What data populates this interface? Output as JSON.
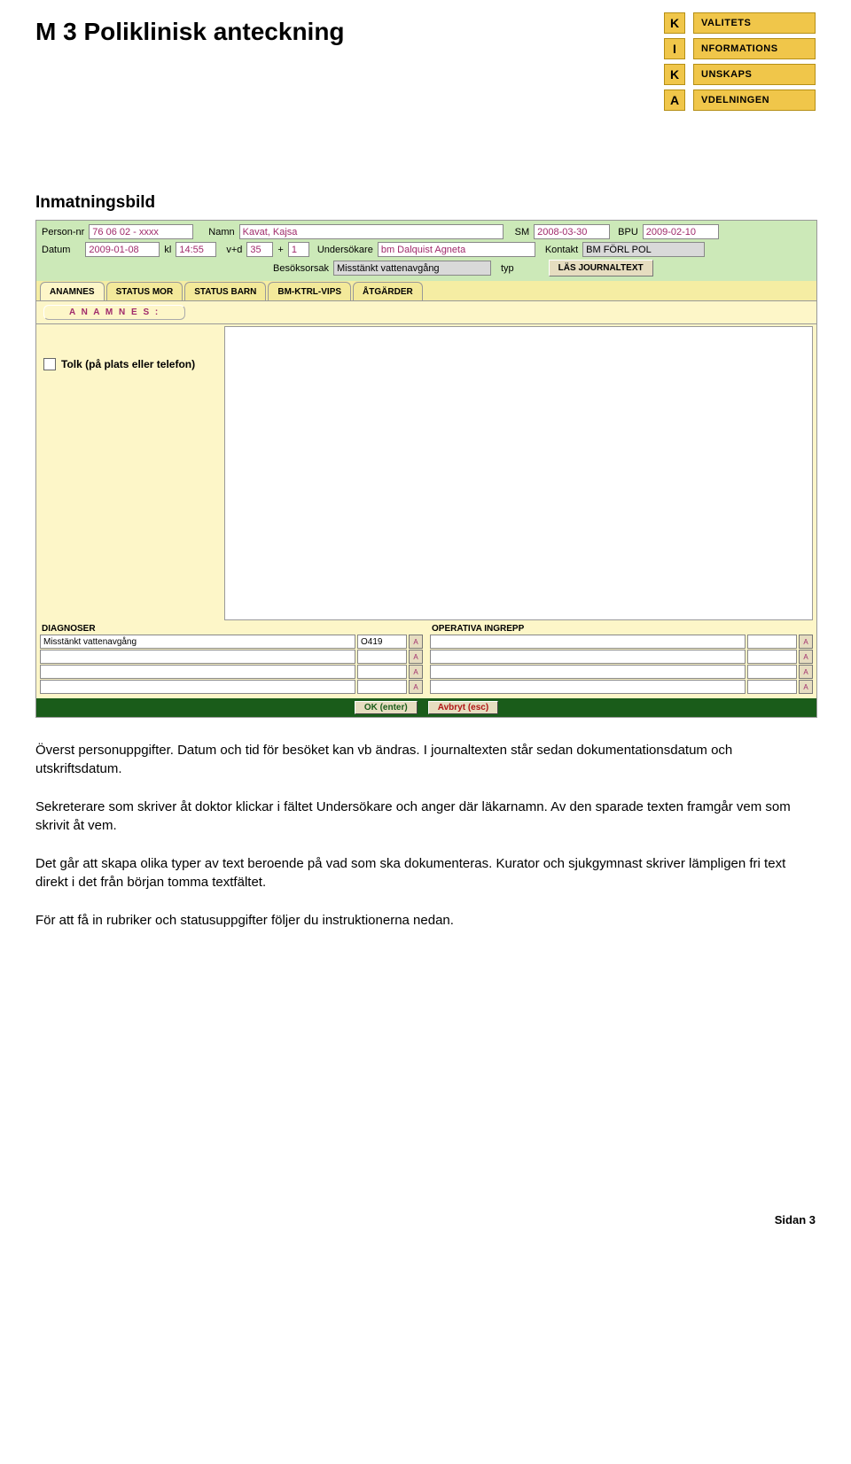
{
  "title": "M 3   Poliklinisk anteckning",
  "kika": [
    {
      "letter": "K",
      "word": "VALITETS"
    },
    {
      "letter": "I",
      "word": "NFORMATIONS"
    },
    {
      "letter": "K",
      "word": "UNSKAPS"
    },
    {
      "letter": "A",
      "word": "VDELNINGEN"
    }
  ],
  "section_heading": "Inmatningsbild",
  "form": {
    "personnr_lbl": "Person-nr",
    "personnr": "76 06 02 - xxxx",
    "namn_lbl": "Namn",
    "namn": "Kavat, Kajsa",
    "sm_lbl": "SM",
    "sm": "2008-03-30",
    "bpu_lbl": "BPU",
    "bpu": "2009-02-10",
    "datum_lbl": "Datum",
    "datum": "2009-01-08",
    "kl_lbl": "kl",
    "kl": "14:55",
    "vd_lbl": "v+d",
    "vd_w": "35",
    "vd_plus": "+",
    "vd_d": "1",
    "undersokare_lbl": "Undersökare",
    "undersokare": "bm Dalquist Agneta",
    "kontakt_lbl": "Kontakt",
    "kontakt": "BM FÖRL POL",
    "besoksorsak_lbl": "Besöksorsak",
    "besoksorsak": "Misstänkt vattenavgång",
    "typ_lbl": "typ",
    "las_btn": "LÄS JOURNALTEXT"
  },
  "tabs": [
    "ANAMNES",
    "STATUS MOR",
    "STATUS BARN",
    "BM-KTRL-VIPS",
    "ÅTGÄRDER"
  ],
  "anamnes_btn": "A N A M N E S :",
  "tolk_label": "Tolk (på plats eller telefon)",
  "diagnoser": {
    "title": "DIAGNOSER",
    "rows": [
      {
        "text": "Misstänkt vattenavgång",
        "code": "O419"
      },
      {
        "text": "",
        "code": ""
      },
      {
        "text": "",
        "code": ""
      },
      {
        "text": "",
        "code": ""
      }
    ]
  },
  "operativa": {
    "title": "OPERATIVA INGREPP",
    "rows": [
      {
        "text": "",
        "code": ""
      },
      {
        "text": "",
        "code": ""
      },
      {
        "text": "",
        "code": ""
      },
      {
        "text": "",
        "code": ""
      }
    ]
  },
  "bottom": {
    "ok": "OK (enter)",
    "avbryt": "Avbryt (esc)"
  },
  "paragraphs": [
    "Överst personuppgifter. Datum och tid för besöket kan vb ändras. I journaltexten står sedan dokumentationsdatum och utskriftsdatum.",
    "Sekreterare som skriver åt doktor klickar i fältet Undersökare och anger där läkarnamn. Av den sparade texten framgår vem som skrivit åt vem.",
    "Det går att skapa olika typer av text beroende på vad som ska dokumenteras. Kurator och sjukgymnast skriver lämpligen fri text direkt i det från början tomma textfältet.",
    "För att få in rubriker och statusuppgifter följer du instruktionerna nedan."
  ],
  "page_num": "Sidan 3"
}
